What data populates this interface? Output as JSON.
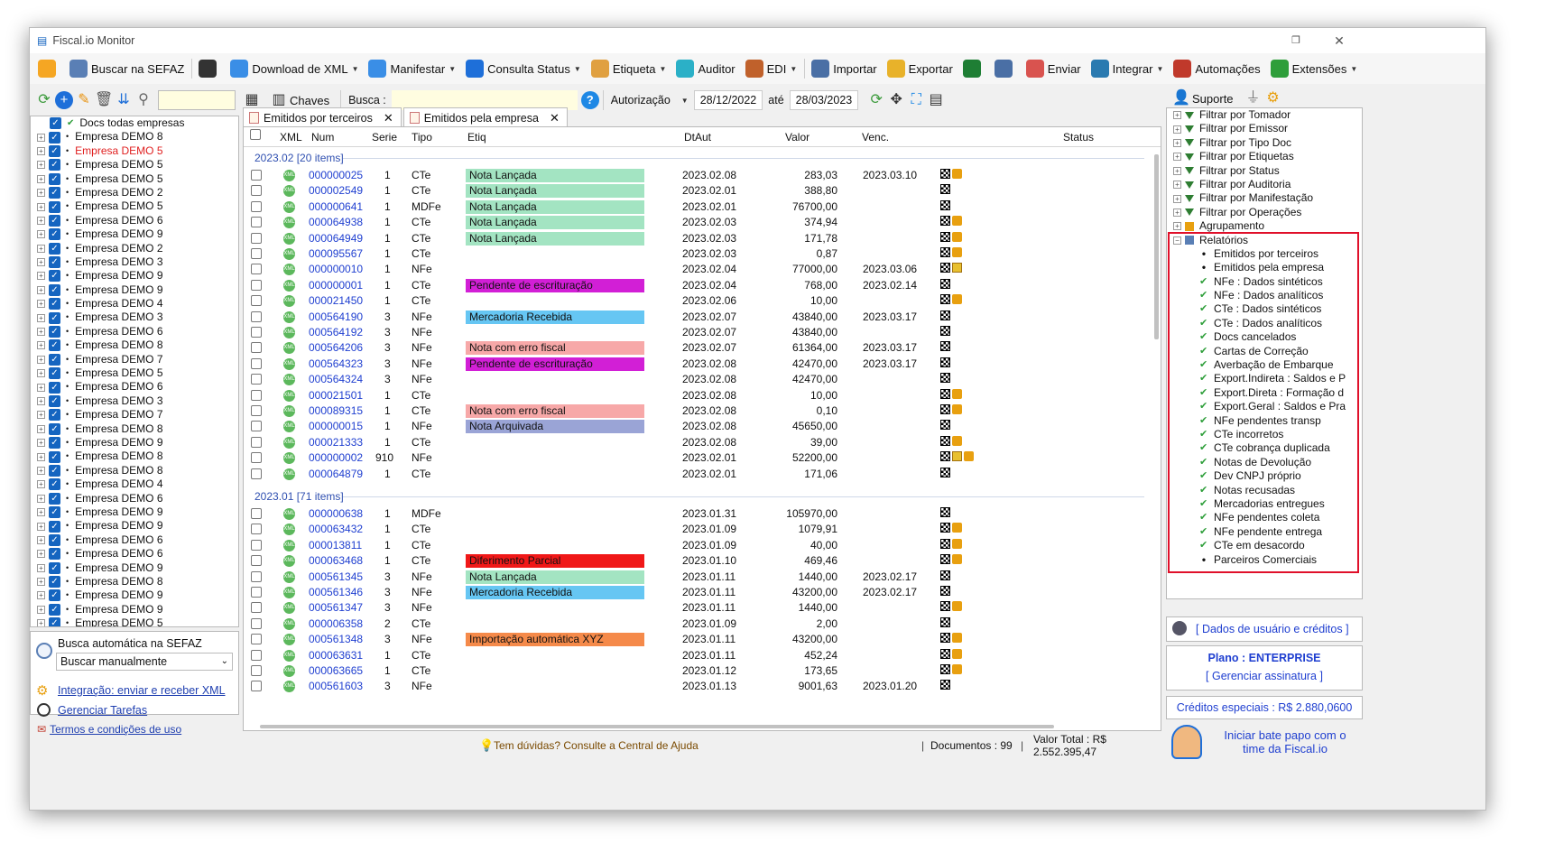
{
  "app": {
    "title": "Fiscal.io Monitor"
  },
  "toolbar": [
    {
      "label": "",
      "icon": "settings-icon",
      "color": "#f5a623"
    },
    {
      "label": "Buscar na SEFAZ",
      "icon": "search-cloud-icon",
      "color": "#5a7fb5"
    },
    {
      "label": "",
      "icon": "document-list-icon",
      "color": "#333"
    },
    {
      "label": "Download de XML",
      "icon": "xml-icon",
      "color": "#3a8ee6",
      "caret": true
    },
    {
      "label": "Manifestar",
      "icon": "manifest-icon",
      "color": "#3a8ee6",
      "caret": true
    },
    {
      "label": "Consulta Status",
      "icon": "check-status-icon",
      "color": "#1e6fd9",
      "caret": true
    },
    {
      "label": "Etiqueta",
      "icon": "tag-icon",
      "color": "#e0a040",
      "caret": true
    },
    {
      "label": "Auditor",
      "icon": "auditor-icon",
      "color": "#2bb0c7"
    },
    {
      "label": "EDI",
      "icon": "truck-icon",
      "color": "#c0612b",
      "caret": true
    },
    {
      "label": "Importar",
      "icon": "import-icon",
      "color": "#4a6fa5"
    },
    {
      "label": "Exportar",
      "icon": "export-icon",
      "color": "#e8b22a"
    },
    {
      "label": "",
      "icon": "excel-icon",
      "color": "#1e7e34"
    },
    {
      "label": "",
      "icon": "printer-icon",
      "color": "#4a6fa5"
    },
    {
      "label": "Enviar",
      "icon": "mail-icon",
      "color": "#d9534f"
    },
    {
      "label": "Integrar",
      "icon": "integrate-icon",
      "color": "#2a7ab0",
      "caret": true
    },
    {
      "label": "Automações",
      "icon": "automation-icon",
      "color": "#c0392b"
    },
    {
      "label": "Extensões",
      "icon": "extensions-icon",
      "color": "#2e9e3a",
      "caret": true
    }
  ],
  "searchbar": {
    "chaves": "Chaves",
    "busca": "Busca :",
    "autorizacao": "Autorização",
    "date_from": "28/12/2022",
    "ate": "até",
    "date_to": "28/03/2023",
    "suporte": "Suporte"
  },
  "companies": {
    "root": "Docs todas empresas",
    "items": [
      "Empresa DEMO 8",
      "Empresa DEMO 5",
      "Empresa DEMO 5",
      "Empresa DEMO 5",
      "Empresa DEMO 2",
      "Empresa DEMO 5",
      "Empresa DEMO 6",
      "Empresa DEMO 9",
      "Empresa DEMO 2",
      "Empresa DEMO 3",
      "Empresa DEMO 9",
      "Empresa DEMO 9",
      "Empresa DEMO 4",
      "Empresa DEMO 3",
      "Empresa DEMO 6",
      "Empresa DEMO 8",
      "Empresa DEMO 7",
      "Empresa DEMO 5",
      "Empresa DEMO 6",
      "Empresa DEMO 3",
      "Empresa DEMO 7",
      "Empresa DEMO 8",
      "Empresa DEMO 9",
      "Empresa DEMO 8",
      "Empresa DEMO 8",
      "Empresa DEMO 4",
      "Empresa DEMO 6",
      "Empresa DEMO 9",
      "Empresa DEMO 9",
      "Empresa DEMO 6",
      "Empresa DEMO 6",
      "Empresa DEMO 9",
      "Empresa DEMO 8",
      "Empresa DEMO 9",
      "Empresa DEMO 9",
      "Empresa DEMO 5"
    ],
    "highlight_index": 1,
    "highlight_color": "#e02020"
  },
  "auto": {
    "label": "Busca automática na SEFAZ",
    "select": "Buscar manualmente",
    "link1": "Integração: enviar e receber XML",
    "link2": "Gerenciar Tarefas"
  },
  "footer": {
    "terms": "Termos e condições de uso",
    "help": "Tem dúvidas? Consulte a Central de Ajuda",
    "docs": "Documentos : 99",
    "total": "Valor Total : R$ 2.552.395,47"
  },
  "tabs": [
    "Emitidos por terceiros",
    "Emitidos pela empresa"
  ],
  "columns": [
    "XML",
    "Num",
    "Serie",
    "Tipo",
    "Etiq",
    "DtAut",
    "Valor",
    "Venc.",
    "Status"
  ],
  "groups": [
    {
      "label": "2023.02 [20 items]",
      "rows": [
        [
          "000000025",
          "1",
          "CTe",
          "Nota Lançada",
          "2023.02.08",
          "283,03",
          "2023.03.10",
          "fb"
        ],
        [
          "000002549",
          "1",
          "CTe",
          "Nota Lançada",
          "2023.02.01",
          "388,80",
          "",
          "f"
        ],
        [
          "000000641",
          "1",
          "MDFe",
          "Nota Lançada",
          "2023.02.01",
          "76700,00",
          "",
          "f"
        ],
        [
          "000064938",
          "1",
          "CTe",
          "Nota Lançada",
          "2023.02.03",
          "374,94",
          "",
          "fb"
        ],
        [
          "000064949",
          "1",
          "CTe",
          "Nota Lançada",
          "2023.02.03",
          "171,78",
          "",
          "fb"
        ],
        [
          "000095567",
          "1",
          "CTe",
          "",
          "2023.02.03",
          "0,87",
          "",
          "fb"
        ],
        [
          "000000010",
          "1",
          "NFe",
          "",
          "2023.02.04",
          "77000,00",
          "2023.03.06",
          "fy"
        ],
        [
          "000000001",
          "1",
          "CTe",
          "Pendente de escrituração",
          "2023.02.04",
          "768,00",
          "2023.02.14",
          "f"
        ],
        [
          "000021450",
          "1",
          "CTe",
          "",
          "2023.02.06",
          "10,00",
          "",
          "fb"
        ],
        [
          "000564190",
          "3",
          "NFe",
          "Mercadoria Recebida",
          "2023.02.07",
          "43840,00",
          "2023.03.17",
          "f"
        ],
        [
          "000564192",
          "3",
          "NFe",
          "",
          "2023.02.07",
          "43840,00",
          "",
          "f"
        ],
        [
          "000564206",
          "3",
          "NFe",
          "Nota com erro fiscal",
          "2023.02.07",
          "61364,00",
          "2023.03.17",
          "f"
        ],
        [
          "000564323",
          "3",
          "NFe",
          "Pendente de escrituração",
          "2023.02.08",
          "42470,00",
          "2023.03.17",
          "f"
        ],
        [
          "000564324",
          "3",
          "NFe",
          "",
          "2023.02.08",
          "42470,00",
          "",
          "f"
        ],
        [
          "000021501",
          "1",
          "CTe",
          "",
          "2023.02.08",
          "10,00",
          "",
          "fb"
        ],
        [
          "000089315",
          "1",
          "CTe",
          "Nota com erro fiscal",
          "2023.02.08",
          "0,10",
          "",
          "fb"
        ],
        [
          "000000015",
          "1",
          "NFe",
          "Nota Arquivada",
          "2023.02.08",
          "45650,00",
          "",
          "f"
        ],
        [
          "000021333",
          "1",
          "CTe",
          "",
          "2023.02.08",
          "39,00",
          "",
          "fb"
        ],
        [
          "000000002",
          "910",
          "NFe",
          "",
          "2023.02.01",
          "52200,00",
          "",
          "fyb"
        ],
        [
          "000064879",
          "1",
          "CTe",
          "",
          "2023.02.01",
          "171,06",
          "",
          "f"
        ]
      ]
    },
    {
      "label": "2023.01 [71 items]",
      "rows": [
        [
          "000000638",
          "1",
          "MDFe",
          "",
          "2023.01.31",
          "105970,00",
          "",
          "f"
        ],
        [
          "000063432",
          "1",
          "CTe",
          "",
          "2023.01.09",
          "1079,91",
          "",
          "fb"
        ],
        [
          "000013811",
          "1",
          "CTe",
          "",
          "2023.01.09",
          "40,00",
          "",
          "fb"
        ],
        [
          "000063468",
          "1",
          "CTe",
          "Diferimento Parcial",
          "2023.01.10",
          "469,46",
          "",
          "fb"
        ],
        [
          "000561345",
          "3",
          "NFe",
          "Nota Lançada",
          "2023.01.11",
          "1440,00",
          "2023.02.17",
          "f"
        ],
        [
          "000561346",
          "3",
          "NFe",
          "Mercadoria Recebida",
          "2023.01.11",
          "43200,00",
          "2023.02.17",
          "f"
        ],
        [
          "000561347",
          "3",
          "NFe",
          "",
          "2023.01.11",
          "1440,00",
          "",
          "fb"
        ],
        [
          "000006358",
          "2",
          "CTe",
          "",
          "2023.01.09",
          "2,00",
          "",
          "f"
        ],
        [
          "000561348",
          "3",
          "NFe",
          "Importação automática XYZ",
          "2023.01.11",
          "43200,00",
          "",
          "fb"
        ],
        [
          "000063631",
          "1",
          "CTe",
          "",
          "2023.01.11",
          "452,24",
          "",
          "fb"
        ],
        [
          "000063665",
          "1",
          "CTe",
          "",
          "2023.01.12",
          "173,65",
          "",
          "fb"
        ],
        [
          "000561603",
          "3",
          "NFe",
          "",
          "2023.01.13",
          "9001,63",
          "2023.01.20",
          "f"
        ]
      ]
    }
  ],
  "tag_colors": {
    "Nota Lançada": "#a3e4c2",
    "Pendente de escrituração": "#d21fd6",
    "Mercadoria Recebida": "#66c6f3",
    "Nota com erro fiscal": "#f7a8a8",
    "Nota Arquivada": "#9aa4d6",
    "Diferimento Parcial": "#f01818",
    "Importação automática XYZ": "#f58a4a"
  },
  "filters": [
    "Filtrar por Tomador",
    "Filtrar por Emissor",
    "Filtrar por Tipo Doc",
    "Filtrar por Etiquetas",
    "Filtrar por Status",
    "Filtrar por Auditoria",
    "Filtrar por Manifestação",
    "Filtrar por Operações",
    "Agrupamento",
    "Relatórios"
  ],
  "reports": [
    {
      "label": "Emitidos por terceiros",
      "mark": "dot"
    },
    {
      "label": "Emitidos pela empresa",
      "mark": "dot"
    },
    {
      "label": "NFe : Dados sintéticos",
      "mark": "check"
    },
    {
      "label": "NFe : Dados analíticos",
      "mark": "check"
    },
    {
      "label": "CTe : Dados sintéticos",
      "mark": "check"
    },
    {
      "label": "CTe : Dados analíticos",
      "mark": "check"
    },
    {
      "label": "Docs cancelados",
      "mark": "check"
    },
    {
      "label": "Cartas de Correção",
      "mark": "check"
    },
    {
      "label": "Averbação de Embarque",
      "mark": "check"
    },
    {
      "label": "Export.Indireta : Saldos e P",
      "mark": "check"
    },
    {
      "label": "Export.Direta : Formação d",
      "mark": "check"
    },
    {
      "label": "Export.Geral : Saldos e Pra",
      "mark": "check"
    },
    {
      "label": "NFe pendentes transp",
      "mark": "check"
    },
    {
      "label": "CTe incorretos",
      "mark": "check"
    },
    {
      "label": "CTe cobrança duplicada",
      "mark": "check"
    },
    {
      "label": "Notas de Devolução",
      "mark": "check"
    },
    {
      "label": "Dev CNPJ próprio",
      "mark": "check"
    },
    {
      "label": "Notas recusadas",
      "mark": "check"
    },
    {
      "label": "Mercadorias entregues",
      "mark": "check"
    },
    {
      "label": "NFe pendentes coleta",
      "mark": "check"
    },
    {
      "label": "NFe pendente entrega",
      "mark": "check"
    },
    {
      "label": "CTe em desacordo",
      "mark": "check"
    },
    {
      "label": "Parceiros Comerciais",
      "mark": "dot"
    }
  ],
  "account": {
    "user_link": "[ Dados de usuário e créditos ]",
    "plan": "Plano : ENTERPRISE",
    "manage": "[ Gerenciar assinatura ]",
    "credits": "Créditos especiais : R$ 2.880,0600",
    "chat": "Iniciar bate papo com o time da Fiscal.io"
  }
}
